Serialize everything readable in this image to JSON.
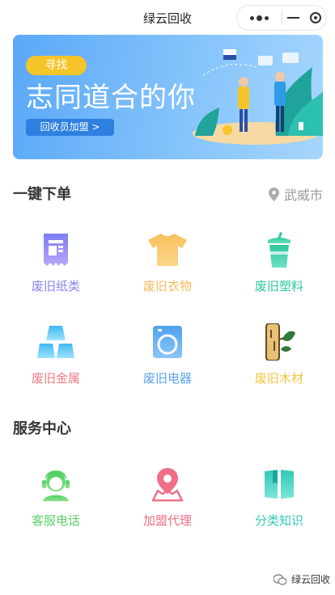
{
  "nav": {
    "title": "绿云回收"
  },
  "banner": {
    "tag": "寻找",
    "title": "志同道合的你",
    "button": "回收员加盟 >"
  },
  "order_section": {
    "title": "一键下单",
    "location": "武威市",
    "items": [
      {
        "label": "废旧纸类",
        "icon": "paper-icon",
        "color": "#8a84f2"
      },
      {
        "label": "废旧衣物",
        "icon": "tshirt-icon",
        "color": "#f6b95a"
      },
      {
        "label": "废旧塑料",
        "icon": "plastic-cup-icon",
        "color": "#2fc7a0"
      },
      {
        "label": "废旧金属",
        "icon": "metal-ingot-icon",
        "color": "#ee7a8a"
      },
      {
        "label": "废旧电器",
        "icon": "washing-machine-icon",
        "color": "#5aa4ec"
      },
      {
        "label": "废旧木材",
        "icon": "wood-log-icon",
        "color": "#f0c640"
      }
    ]
  },
  "service_section": {
    "title": "服务中心",
    "items": [
      {
        "label": "客服电话",
        "icon": "customer-service-icon",
        "color": "#5bd26a"
      },
      {
        "label": "加盟代理",
        "icon": "map-pin-icon",
        "color": "#ee6f86"
      },
      {
        "label": "分类知识",
        "icon": "book-icon",
        "color": "#35c9b8"
      }
    ]
  },
  "watermark": {
    "text": "绿云回收"
  }
}
